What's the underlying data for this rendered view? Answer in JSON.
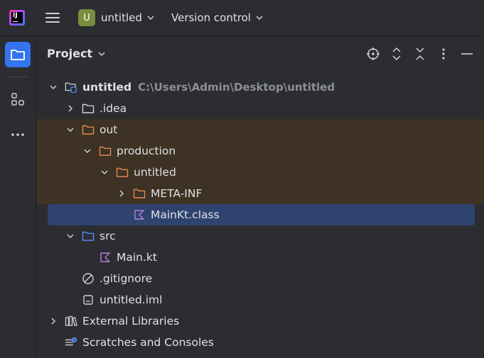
{
  "titlebar": {
    "project_badge": "U",
    "project_name": "untitled",
    "vcs_label": "Version control"
  },
  "toolstrip": {
    "items": [
      "project",
      "structure",
      "more"
    ]
  },
  "panel": {
    "title": "Project"
  },
  "tree": [
    {
      "label": "untitled",
      "path": "C:\\Users\\Admin\\Desktop\\untitled",
      "depth": 0,
      "arrow": "down",
      "icon": "module-folder",
      "bold": true
    },
    {
      "label": ".idea",
      "depth": 1,
      "arrow": "right",
      "icon": "folder"
    },
    {
      "label": "out",
      "depth": 1,
      "arrow": "down",
      "icon": "folder-orange",
      "highlight": true
    },
    {
      "label": "production",
      "depth": 2,
      "arrow": "down",
      "icon": "folder-orange",
      "highlight": true
    },
    {
      "label": "untitled",
      "depth": 3,
      "arrow": "down",
      "icon": "folder-orange",
      "highlight": true
    },
    {
      "label": "META-INF",
      "depth": 4,
      "arrow": "right",
      "icon": "folder-orange",
      "highlight": true
    },
    {
      "label": "MainKt.class",
      "depth": 4,
      "arrow": "",
      "icon": "kotlin-class",
      "selected": true
    },
    {
      "label": "src",
      "depth": 1,
      "arrow": "down",
      "icon": "folder-blue"
    },
    {
      "label": "Main.kt",
      "depth": 2,
      "arrow": "",
      "icon": "kotlin-file"
    },
    {
      "label": ".gitignore",
      "depth": 1,
      "arrow": "",
      "icon": "ignore-file"
    },
    {
      "label": "untitled.iml",
      "depth": 1,
      "arrow": "",
      "icon": "iml-file"
    },
    {
      "label": "External Libraries",
      "depth": 0,
      "arrow": "right",
      "icon": "libraries"
    },
    {
      "label": "Scratches and Consoles",
      "depth": 0,
      "arrow": "",
      "icon": "scratches"
    }
  ]
}
